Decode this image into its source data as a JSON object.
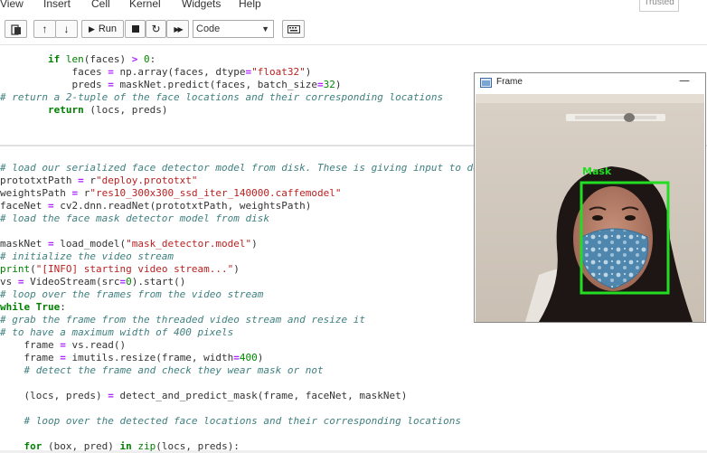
{
  "menu": [
    "View",
    "Insert",
    "Cell",
    "Kernel",
    "Widgets",
    "Help"
  ],
  "trusted": "Trusted",
  "toolbar": {
    "run_label": "Run",
    "cell_type": "Code"
  },
  "frame": {
    "title": "Frame",
    "label": "Mask",
    "box_color": "#22dd22"
  },
  "colors": {
    "comment": "#408080",
    "keyword": "#008000",
    "string": "#ba2121"
  }
}
